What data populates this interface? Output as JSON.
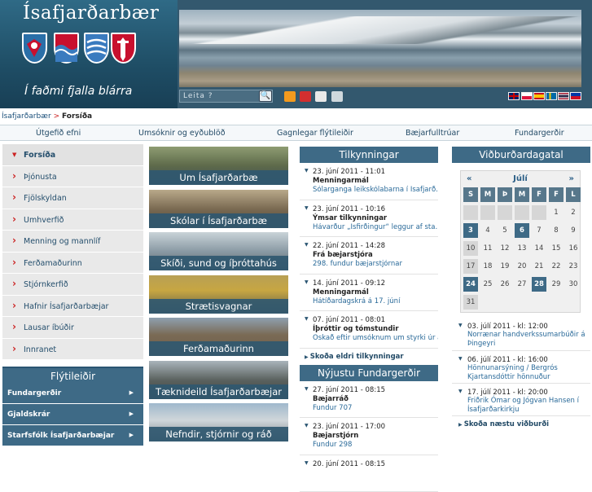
{
  "header": {
    "site_title": "Ísafjarðarbær",
    "slogan": "Í faðmi fjalla blárra",
    "search_placeholder": "Leita ?",
    "search_button": "🔍",
    "crests": [
      "flateyri-crest-icon",
      "isafjordur-crest-icon",
      "thingeyri-crest-icon",
      "sudureyri-crest-icon"
    ],
    "tools": [
      "rss-icon",
      "pdf-icon",
      "email-icon",
      "print-icon"
    ],
    "flags": [
      "uk-flag-icon",
      "poland-flag-icon",
      "spain-flag-icon",
      "sweden-flag-icon",
      "thailand-flag-icon",
      "philippines-flag-icon"
    ]
  },
  "breadcrumb": {
    "home": "Ísafjarðarbær",
    "sep": ">",
    "current": "Forsíða"
  },
  "topnav": [
    "Útgefið efni",
    "Umsóknir og eyðublöð",
    "Gagnlegar flýtileiðir",
    "Bæjarfulltrúar",
    "Fundargerðir"
  ],
  "sidebar": {
    "items": [
      "Forsíða",
      "Þjónusta",
      "Fjölskyldan",
      "Umhverfið",
      "Menning og mannlíf",
      "Ferðamaðurinn",
      "Stjórnkerfið",
      "Hafnir Ísafjarðarbæjar",
      "Lausar íbúðir",
      "Innranet"
    ],
    "shortcuts_title": "Flýtileiðir",
    "shortcuts": [
      "Fundargerðir",
      "Gjaldskrár",
      "Starfsfólk Ísafjarðarbæjar"
    ]
  },
  "tiles": [
    "Um Ísafjarðarbæ",
    "Skólar í Ísafjarðarbæ",
    "Skíði, sund og íþróttahús",
    "Strætisvagnar",
    "Ferðamaðurinn",
    "Tæknideild Ísafjarðarbæjar",
    "Nefndir, stjórnir og ráð"
  ],
  "announcements": {
    "title": "Tilkynningar",
    "items": [
      {
        "date": "23. júní 2011 - 11:01",
        "cat": "Menningarmál",
        "text": "Sólarganga leikskólabarna í Ísafjarð.."
      },
      {
        "date": "23. júní 2011 - 10:16",
        "cat": "Ýmsar tilkynningar",
        "text": "Hávarður „Ísfirðingur“ leggur af sta.."
      },
      {
        "date": "22. júní 2011 - 14:28",
        "cat": "Frá bæjarstjóra",
        "text": "298. fundur bæjarstjórnar"
      },
      {
        "date": "14. júní 2011 - 09:12",
        "cat": "Menningarmál",
        "text": "Hátíðardagskrá á 17. júní"
      },
      {
        "date": "07. júní 2011 - 08:01",
        "cat": "Íþróttir og tómstundir",
        "text": "Óskað eftir umsóknum um styrki úr af.."
      }
    ],
    "more": "Skoða eldri tilkynningar"
  },
  "minutes": {
    "title": "Nýjustu Fundargerðir",
    "items": [
      {
        "date": "27. júní 2011 - 08:15",
        "cat": "Bæjarráð",
        "text": "Fundur 707"
      },
      {
        "date": "23. júní 2011 - 17:00",
        "cat": "Bæjarstjórn",
        "text": "Fundur 298"
      },
      {
        "date": "20. júní 2011 - 08:15",
        "cat": "",
        "text": ""
      }
    ]
  },
  "events": {
    "title": "Viðburðardagatal",
    "calendar": {
      "prev": "«",
      "next": "»",
      "month": "Júlí",
      "weekdays": [
        "S",
        "M",
        "Þ",
        "M",
        "F",
        "F",
        "L"
      ],
      "days": [
        "",
        "",
        "",
        "",
        "",
        "1",
        "2",
        "3",
        "4",
        "5",
        "6",
        "7",
        "8",
        "9",
        "10",
        "11",
        "12",
        "13",
        "14",
        "15",
        "16",
        "17",
        "18",
        "19",
        "20",
        "21",
        "22",
        "23",
        "24",
        "25",
        "26",
        "27",
        "28",
        "29",
        "30",
        "31"
      ],
      "highlighted": [
        "3",
        "6",
        "24",
        "28"
      ]
    },
    "items": [
      {
        "date": "03. júlí 2011 - kl: 12:00",
        "text": "Norrænar handverkssumarbúðir á Þingeyri"
      },
      {
        "date": "06. júlí 2011 - kl: 16:00",
        "text": "Hönnunarsýning / Bergrós Kjartansdóttir hönnuður"
      },
      {
        "date": "17. júlí 2011 - kl: 20:00",
        "text": "Friðrik Ómar og Jógvan Hansen í Ísafjarðarkirkju"
      }
    ],
    "more": "Skoða næstu viðburði"
  },
  "colors": {
    "brand": "#3e6a86",
    "link": "#2a6a99",
    "accent": "#c22222"
  }
}
